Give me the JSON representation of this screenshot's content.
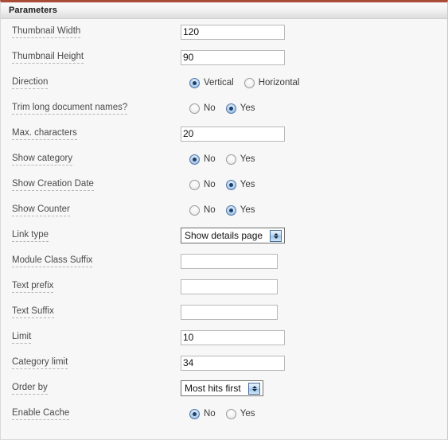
{
  "panel": {
    "title": "Parameters",
    "accent_color": "#a94b36",
    "background_color": "#f7f7f7",
    "header_gradient_from": "#fbfbfb",
    "header_gradient_to": "#dcdcdc"
  },
  "fields": [
    {
      "label": "Thumbnail Width",
      "type": "text",
      "value": "120",
      "name": "thumbnail-width"
    },
    {
      "label": "Thumbnail Height",
      "type": "text",
      "value": "90",
      "name": "thumbnail-height"
    },
    {
      "label": "Direction",
      "type": "radio",
      "name": "direction",
      "options": [
        {
          "label": "Vertical",
          "checked": true
        },
        {
          "label": "Horizontal",
          "checked": false
        }
      ]
    },
    {
      "label": "Trim long document names?",
      "type": "radio",
      "name": "trim-long-document-names",
      "options": [
        {
          "label": "No",
          "checked": false
        },
        {
          "label": "Yes",
          "checked": true
        }
      ]
    },
    {
      "label": "Max. characters",
      "type": "text",
      "value": "20",
      "name": "max-characters"
    },
    {
      "label": "Show category",
      "type": "radio",
      "name": "show-category",
      "options": [
        {
          "label": "No",
          "checked": true
        },
        {
          "label": "Yes",
          "checked": false
        }
      ]
    },
    {
      "label": "Show Creation Date",
      "type": "radio",
      "name": "show-creation-date",
      "options": [
        {
          "label": "No",
          "checked": false
        },
        {
          "label": "Yes",
          "checked": true
        }
      ]
    },
    {
      "label": "Show Counter",
      "type": "radio",
      "name": "show-counter",
      "options": [
        {
          "label": "No",
          "checked": false
        },
        {
          "label": "Yes",
          "checked": true
        }
      ]
    },
    {
      "label": "Link type",
      "type": "select",
      "value": "Show details page",
      "name": "link-type"
    },
    {
      "label": "Module Class Suffix",
      "type": "text",
      "value": "",
      "name": "module-class-suffix"
    },
    {
      "label": "Text prefix",
      "type": "text",
      "value": "",
      "name": "text-prefix"
    },
    {
      "label": "Text Suffix",
      "type": "text",
      "value": "",
      "name": "text-suffix"
    },
    {
      "label": "Limit",
      "type": "text",
      "value": "10",
      "name": "limit"
    },
    {
      "label": "Category limit",
      "type": "text",
      "value": "34",
      "name": "category-limit"
    },
    {
      "label": "Order by",
      "type": "select",
      "value": "Most hits first",
      "name": "order-by"
    },
    {
      "label": "Enable Cache",
      "type": "radio",
      "name": "enable-cache",
      "options": [
        {
          "label": "No",
          "checked": true
        },
        {
          "label": "Yes",
          "checked": false
        }
      ]
    }
  ]
}
